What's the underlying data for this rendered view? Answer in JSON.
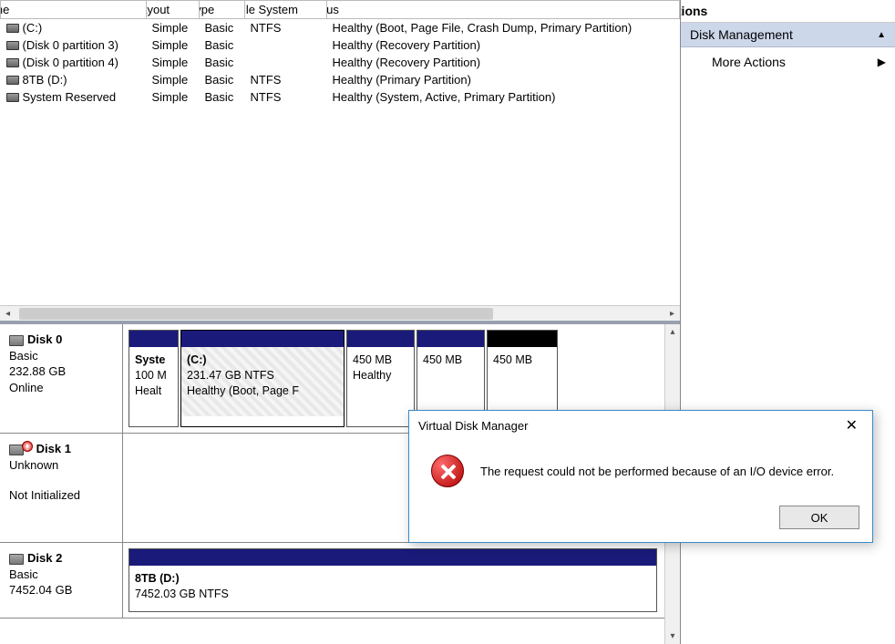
{
  "columns": {
    "volume": "Volume",
    "layout": "Layout",
    "type": "Type",
    "filesystem": "File System",
    "status": "Status"
  },
  "volumes": [
    {
      "name": "(C:)",
      "layout": "Simple",
      "type": "Basic",
      "fs": "NTFS",
      "status": "Healthy (Boot, Page File, Crash Dump, Primary Partition)"
    },
    {
      "name": "(Disk 0 partition 3)",
      "layout": "Simple",
      "type": "Basic",
      "fs": "",
      "status": "Healthy (Recovery Partition)"
    },
    {
      "name": "(Disk 0 partition 4)",
      "layout": "Simple",
      "type": "Basic",
      "fs": "",
      "status": "Healthy (Recovery Partition)"
    },
    {
      "name": "8TB (D:)",
      "layout": "Simple",
      "type": "Basic",
      "fs": "NTFS",
      "status": "Healthy (Primary Partition)"
    },
    {
      "name": "System Reserved",
      "layout": "Simple",
      "type": "Basic",
      "fs": "NTFS",
      "status": "Healthy (System, Active, Primary Partition)"
    }
  ],
  "disks": {
    "disk0": {
      "title": "Disk 0",
      "type": "Basic",
      "size": "232.88 GB",
      "state": "Online",
      "parts": [
        {
          "label": "Syste",
          "l2": "100 M",
          "l3": "Healt"
        },
        {
          "label": "(C:)",
          "l2": "231.47 GB NTFS",
          "l3": "Healthy (Boot, Page F"
        },
        {
          "label": "",
          "l2": "450 MB",
          "l3": "Healthy "
        },
        {
          "label": "",
          "l2": "450 MB",
          "l3": ""
        },
        {
          "label": "",
          "l2": "450 MB",
          "l3": ""
        }
      ]
    },
    "disk1": {
      "title": "Disk 1",
      "type": "Unknown",
      "size": "",
      "state": "Not Initialized"
    },
    "disk2": {
      "title": "Disk 2",
      "type": "Basic",
      "size": "7452.04 GB",
      "part": {
        "label": "8TB  (D:)",
        "l2": "7452.03 GB NTFS"
      }
    }
  },
  "actions": {
    "header": "Actions",
    "sub": "Disk Management",
    "more": "More Actions"
  },
  "dialog": {
    "title": "Virtual Disk Manager",
    "message": "The request could not be performed because of an I/O device error.",
    "ok": "OK"
  }
}
